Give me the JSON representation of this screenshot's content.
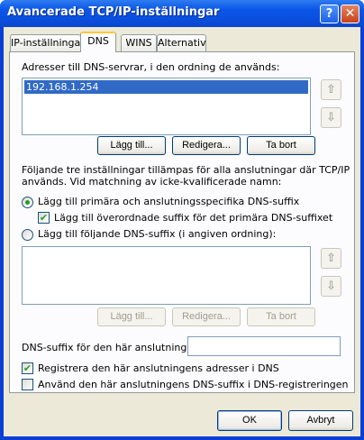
{
  "window": {
    "title": "Avancerade TCP/IP-inställningar",
    "help_glyph": "?",
    "close_glyph": "✕"
  },
  "tabs": [
    {
      "label": "IP-inställningar",
      "active": false
    },
    {
      "label": "DNS",
      "active": true
    },
    {
      "label": "WINS",
      "active": false
    },
    {
      "label": "Alternativ",
      "active": false
    }
  ],
  "dns": {
    "servers_label": "Adresser till DNS-servrar, i den ordning de används:",
    "servers": [
      "192.168.1.254"
    ],
    "up_glyph": "⇧",
    "down_glyph": "⇩",
    "add_label": "Lägg till...",
    "edit_label": "Redigera...",
    "remove_label": "Ta bort",
    "info_line1": "Följande tre inställningar tillämpas för alla anslutningar där TCP/IP",
    "info_line2": "används. Vid matchning av icke-kvalificerade namn:",
    "radio_primary_label": "Lägg till primära och anslutningsspecifika DNS-suffix",
    "check_parent_label": "Lägg till överordnade suffix för det primära DNS-suffixet",
    "radio_list_label": "Lägg till följande DNS-suffix (i angiven ordning):",
    "suffix_add_label": "Lägg till...",
    "suffix_edit_label": "Redigera...",
    "suffix_remove_label": "Ta bort",
    "conn_suffix_label": "DNS-suffix för den här anslutningen:",
    "conn_suffix_value": "",
    "register_label": "Registrera den här anslutningens adresser i DNS",
    "use_suffix_label": "Använd den här anslutningens DNS-suffix i DNS-registreringen",
    "check_glyph": "✔"
  },
  "footer": {
    "ok_label": "OK",
    "cancel_label": "Avbryt"
  }
}
